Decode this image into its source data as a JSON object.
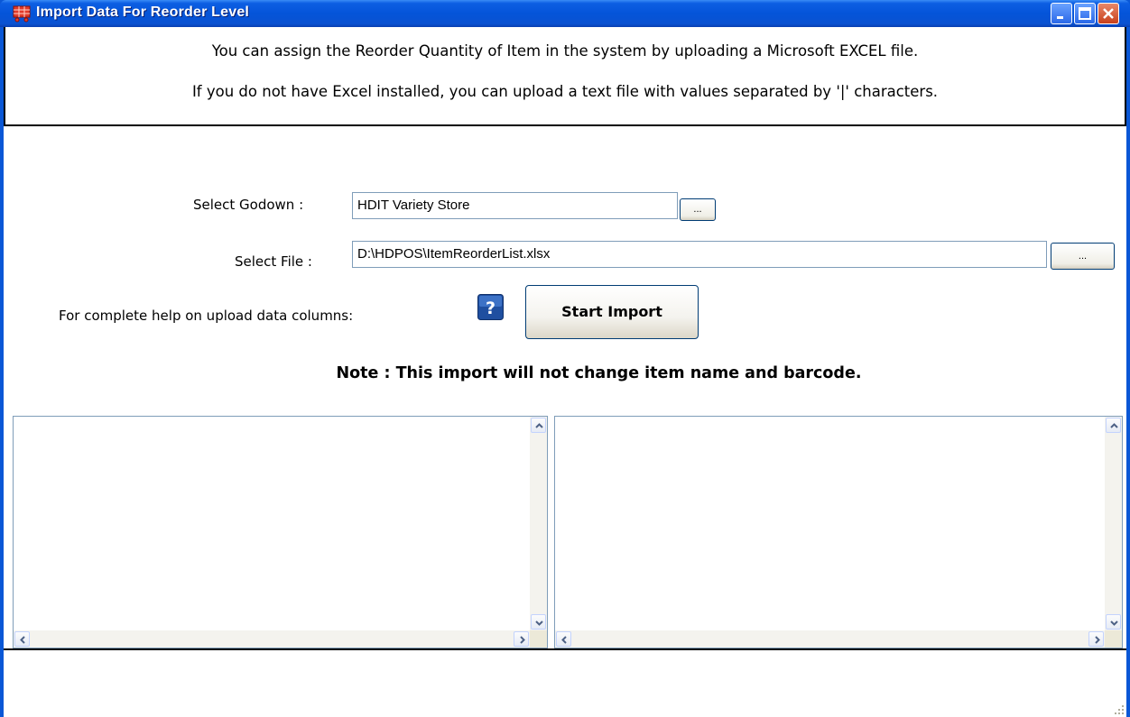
{
  "window": {
    "title": "Import Data For Reorder Level",
    "icon": "shopping-cart-icon"
  },
  "info": {
    "line1": "You can assign  the Reorder Quantity of Item in the system by uploading a Microsoft EXCEL  file.",
    "line2": "If you do not have Excel installed, you can upload a text file with values separated by '|' characters."
  },
  "form": {
    "godown_label": "Select Godown :",
    "godown_value": "HDIT Variety Store",
    "godown_browse": "...",
    "file_label": "Select File :",
    "file_value": "D:\\HDPOS\\ItemReorderList.xlsx",
    "file_browse": "...",
    "help_label": "For complete help on upload data columns:",
    "help_icon_text": "?",
    "start_button": "Start Import",
    "note": "Note : This import will not change item name and barcode."
  },
  "colors": {
    "titlebar": "#0454d9",
    "border": "#7f9db9"
  }
}
